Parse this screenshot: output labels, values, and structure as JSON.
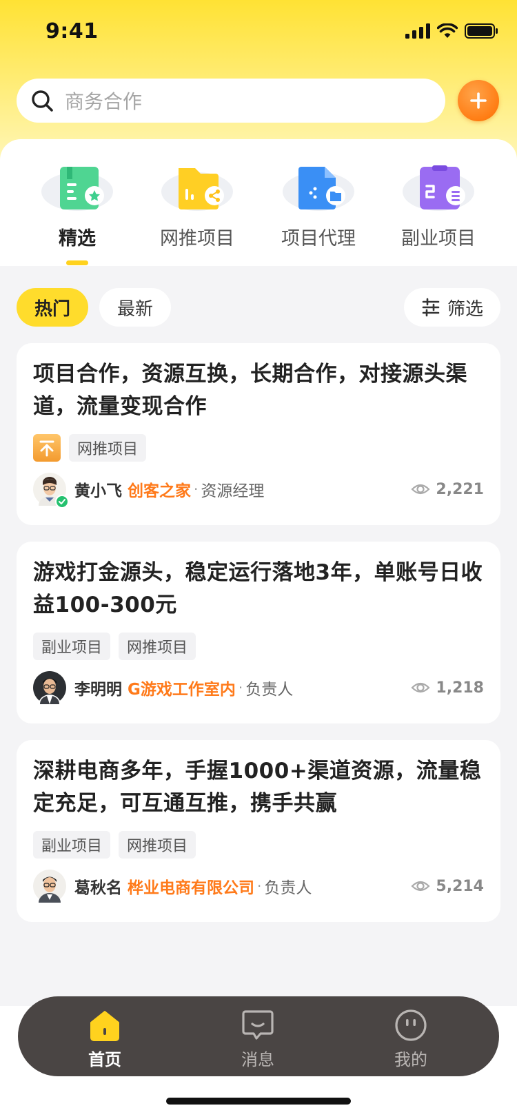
{
  "status_bar": {
    "time": "9:41",
    "icons": [
      "signal-icon",
      "wifi-icon",
      "battery-icon"
    ]
  },
  "search": {
    "placeholder": "商务合作",
    "icon": "search-icon"
  },
  "add_button": {
    "icon": "plus-icon"
  },
  "categories": [
    {
      "label": "精选",
      "icon": "bookmark-star-icon",
      "color": "#3ecf8e",
      "active": true
    },
    {
      "label": "网推项目",
      "icon": "folder-share-icon",
      "color": "#ffcc1f",
      "active": false
    },
    {
      "label": "项目代理",
      "icon": "file-folder-icon",
      "color": "#3a8ff5",
      "active": false
    },
    {
      "label": "副业项目",
      "icon": "clipboard-list-icon",
      "color": "#9a6cf2",
      "active": false
    }
  ],
  "filters": {
    "hot": "热门",
    "latest": "最新",
    "filter": "筛选",
    "filter_icon": "sliders-icon"
  },
  "posts": [
    {
      "title": "项目合作，资源互换，长期合作，对接源头渠道，流量变现合作",
      "pinned": true,
      "tags": [
        "网推项目"
      ],
      "user": "黄小飞",
      "company": "创客之家",
      "role": "资源经理",
      "views": "2,221",
      "verified": true
    },
    {
      "title": "游戏打金源头，稳定运行落地3年，单账号日收益100-300元",
      "pinned": false,
      "tags": [
        "副业项目",
        "网推项目"
      ],
      "user": "李明明",
      "company": "G游戏工作室内",
      "role": "负责人",
      "views": "1,218",
      "verified": false
    },
    {
      "title": "深耕电商多年，手握1000+渠道资源，流量稳定充足，可互通互推，携手共赢",
      "pinned": false,
      "tags": [
        "副业项目",
        "网推项目"
      ],
      "user": "葛秋名",
      "company": "桦业电商有限公司",
      "role": "负责人",
      "views": "5,214",
      "verified": false
    }
  ],
  "separator": "·",
  "bottom_nav": [
    {
      "label": "首页",
      "icon": "home-icon",
      "active": true
    },
    {
      "label": "消息",
      "icon": "message-icon",
      "active": false
    },
    {
      "label": "我的",
      "icon": "profile-icon",
      "active": false
    }
  ],
  "colors": {
    "brand_yellow": "#ffdc2c",
    "accent_orange": "#ff7a1a",
    "nav_bg": "#4a4544"
  }
}
